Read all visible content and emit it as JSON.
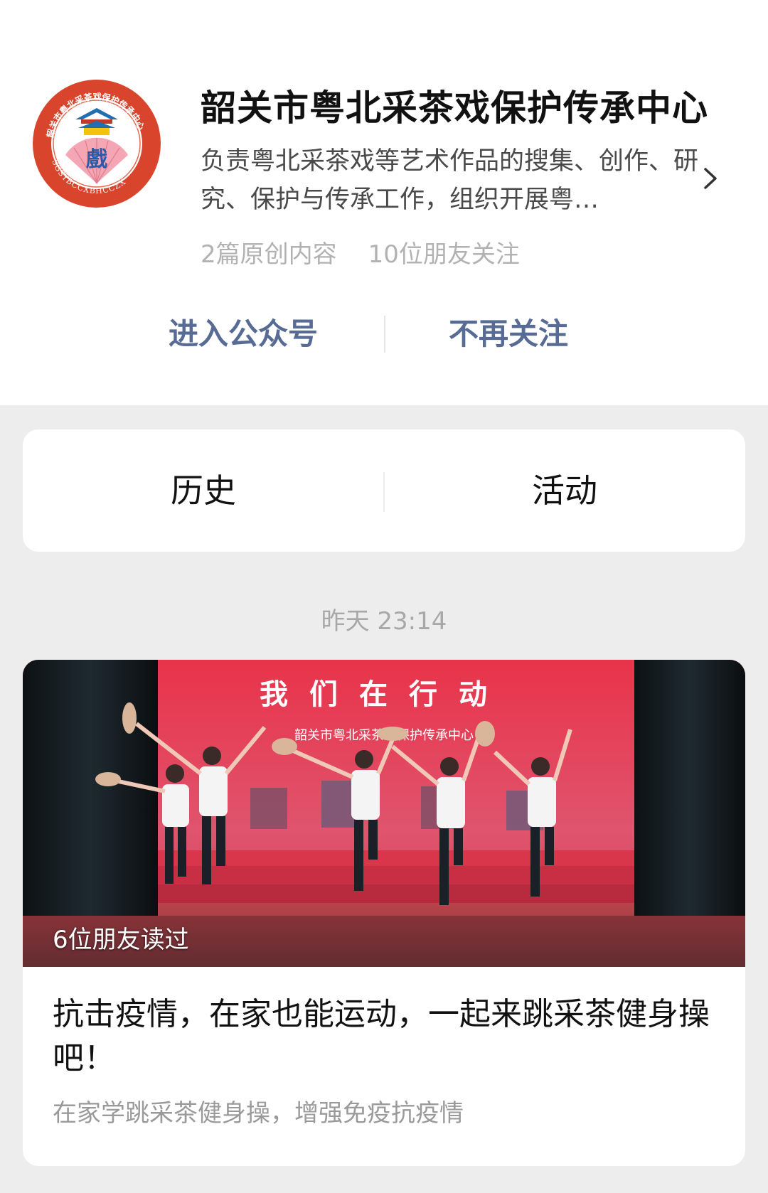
{
  "account": {
    "name": "韶关市粤北采茶戏保护传承中心",
    "description": "负责粤北采茶戏等艺术作品的搜集、创作、研究、保护与传承工作，组织开展粤…",
    "original_count": "2篇原创内容",
    "friends_following": "10位朋友关注",
    "logo": {
      "ring_text": "韶关市粤北采茶戏保护传承中心",
      "abbrev": "SGSYBCCXBHCCZX",
      "glyph": "戲",
      "ring_color": "#d8452c"
    },
    "icons": [
      "chevron-right-icon"
    ]
  },
  "actions": {
    "enter_label": "进入公众号",
    "unfollow_label": "不再关注",
    "accent": "#576b95"
  },
  "tabs": [
    {
      "label": "历史"
    },
    {
      "label": "活动"
    }
  ],
  "feed": {
    "timestamp": "昨天 23:14",
    "article": {
      "cover_banner": "我们在行动",
      "cover_org": "韶关市粤北采茶戏保护传承中心",
      "read_by": "6位朋友读过",
      "title": "抗击疫情，在家也能运动，一起来跳采茶健身操吧！",
      "digest": "在家学跳采茶健身操，增强免疫抗疫情"
    }
  }
}
